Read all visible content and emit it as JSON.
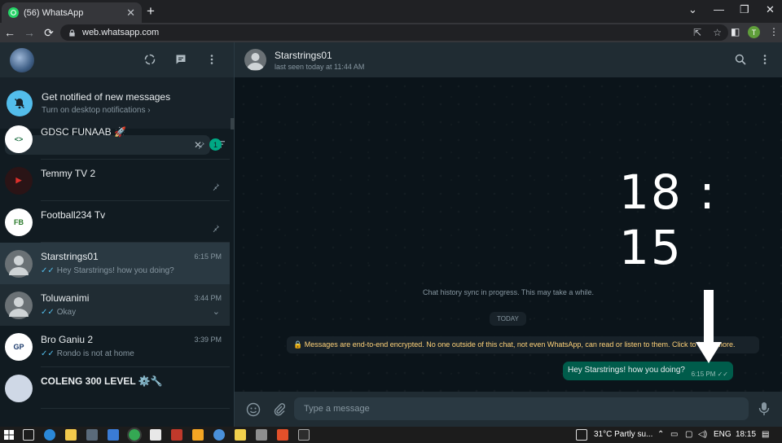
{
  "browser": {
    "tab_title": "(56) WhatsApp",
    "tab_close": "✕",
    "new_tab": "+",
    "url": "web.whatsapp.com",
    "window_min": "⌄",
    "window_minimize": "—",
    "window_restore": "❐",
    "window_close": "✕",
    "profile_initial": "T"
  },
  "notification": {
    "title": "Get notified of new messages",
    "subtitle": "Turn on desktop notifications ›"
  },
  "search": {
    "placeholder": "",
    "value": ""
  },
  "chats": [
    {
      "name": "GDSC FUNAAB 🚀",
      "message": "",
      "time": "",
      "unread": "1",
      "pinned": true,
      "avatar_text": "<>"
    },
    {
      "name": "Temmy TV 2",
      "message": "",
      "time": "",
      "pinned": true,
      "avatar_text": "▶"
    },
    {
      "name": "Football234 Tv",
      "message": "",
      "time": "",
      "pinned": true,
      "avatar_text": "FB"
    },
    {
      "name": "Starstrings01",
      "message": "Hey Starstrings! how you doing?",
      "time": "6:15 PM",
      "ticks": "✓✓"
    },
    {
      "name": "Toluwanimi",
      "message": "Okay",
      "time": "3:44 PM",
      "ticks": "✓✓"
    },
    {
      "name": "Bro Ganiu 2",
      "message": "Rondo is not at home",
      "time": "3:39 PM",
      "ticks": "✓✓"
    },
    {
      "name": "COLENG 300 LEVEL ⚙️🔧",
      "message": "",
      "time": ""
    }
  ],
  "conversation": {
    "name": "Starstrings01",
    "status": "last seen today at 11:44 AM",
    "clock": "18 : 15",
    "sync_notice": "Chat history sync in progress. This may take a while.",
    "date_chip": "TODAY",
    "encryption_notice": "🔒 Messages are end-to-end encrypted. No one outside of this chat, not even WhatsApp, can read or listen to them. Click to learn more.",
    "message_text": "Hey Starstrings! how you doing?",
    "message_time": "6:15 PM ✓✓",
    "composer_placeholder": "Type a message"
  },
  "taskbar": {
    "weather": "31°C  Partly su...",
    "language": "ENG",
    "time": "18:15"
  },
  "colors": {
    "accent": "#00a884",
    "header": "#202c33",
    "bubble_out": "#005c4b",
    "ticks_read": "#53bdeb"
  }
}
